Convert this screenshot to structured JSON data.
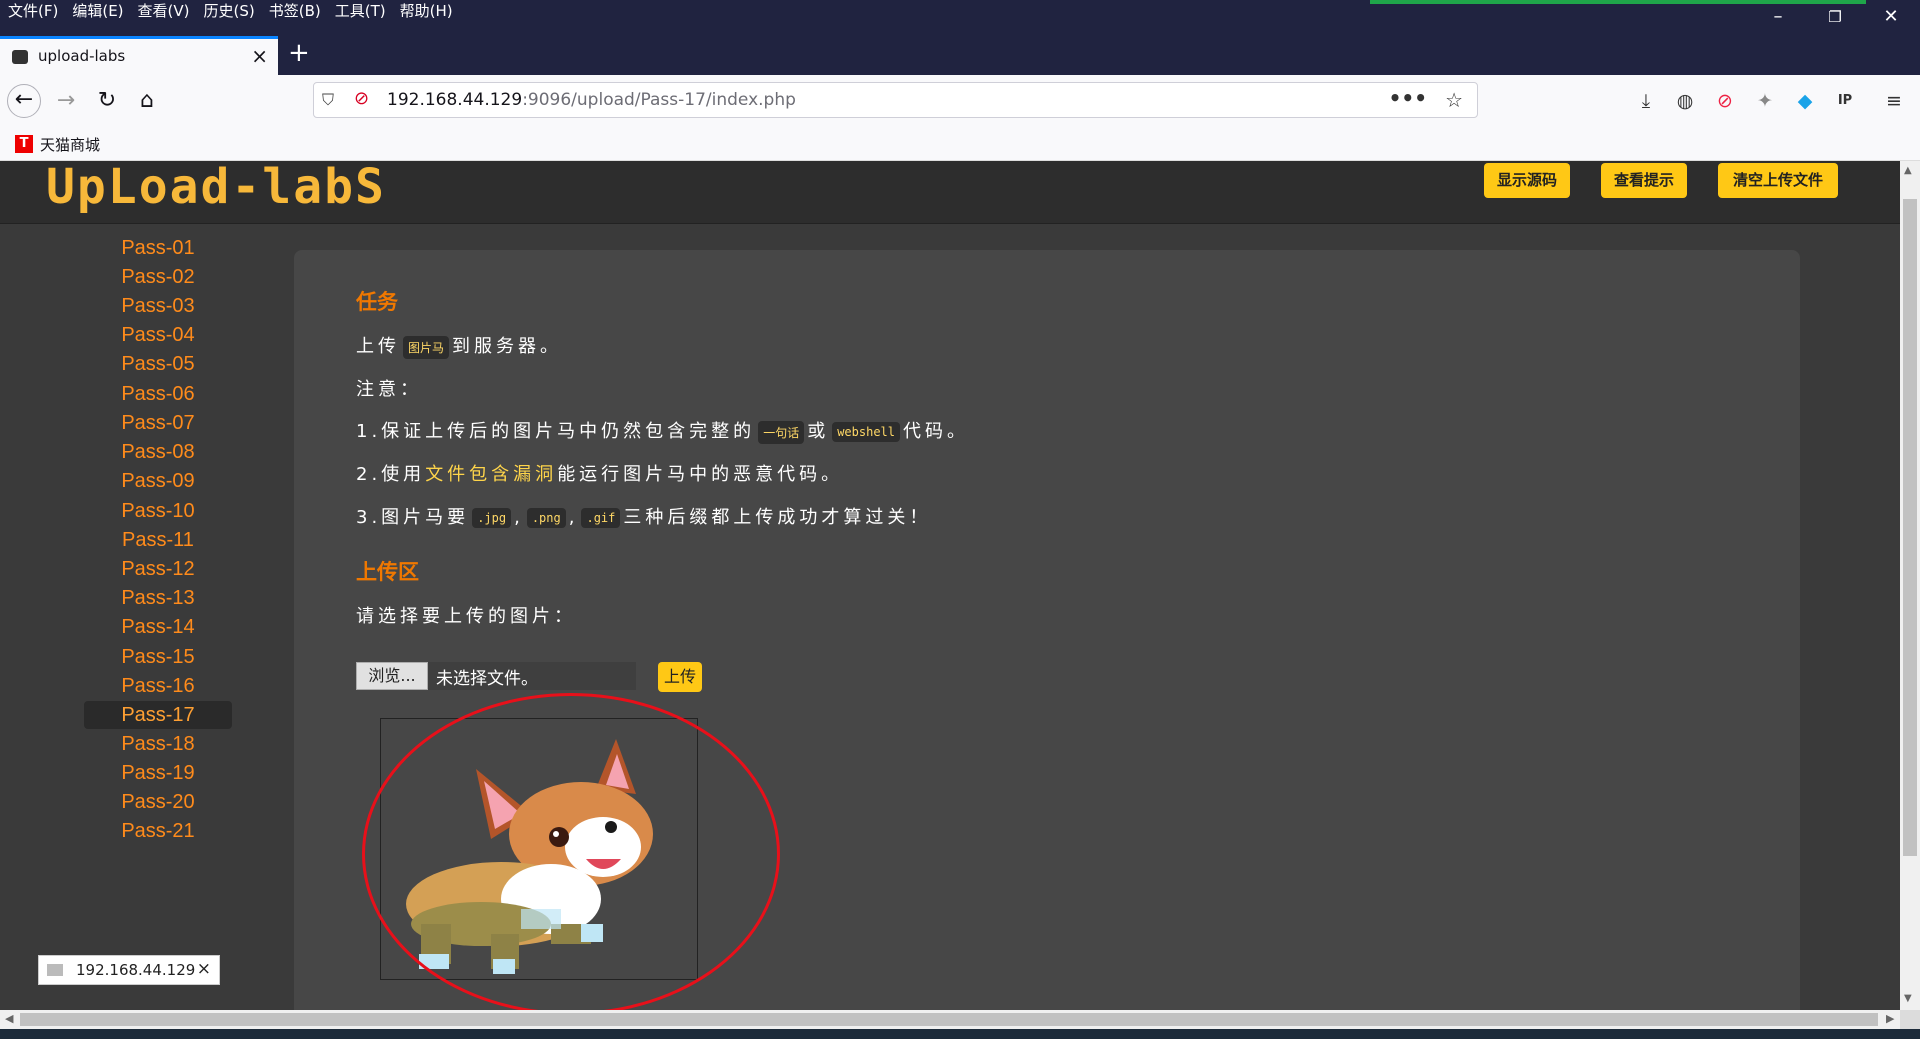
{
  "menubar": {
    "items": [
      "文件(F)",
      "编辑(E)",
      "查看(V)",
      "历史(S)",
      "书签(B)",
      "工具(T)",
      "帮助(H)"
    ]
  },
  "tab": {
    "title": "upload-labs"
  },
  "url": {
    "host": "192.168.44.129",
    "path": ":9096/upload/Pass-17/index.php"
  },
  "bookmarks": {
    "tmall_icon": "T",
    "tmall_label": "天猫商城"
  },
  "header": {
    "logo": "UpLoad-labS",
    "buttons": [
      "显示源码",
      "查看提示",
      "清空上传文件"
    ]
  },
  "sidebar": {
    "items": [
      "Pass-01",
      "Pass-02",
      "Pass-03",
      "Pass-04",
      "Pass-05",
      "Pass-06",
      "Pass-07",
      "Pass-08",
      "Pass-09",
      "Pass-10",
      "Pass-11",
      "Pass-12",
      "Pass-13",
      "Pass-14",
      "Pass-15",
      "Pass-16",
      "Pass-17",
      "Pass-18",
      "Pass-19",
      "Pass-20",
      "Pass-21"
    ],
    "active": "Pass-17"
  },
  "task": {
    "heading": "任务",
    "line1_a": "上传",
    "line1_code": "图片马",
    "line1_b": "到服务器。",
    "note": "注意：",
    "note1_a": "1.保证上传后的图片马中仍然包含完整的",
    "note1_code1": "一句话",
    "note1_b": "或",
    "note1_code2": "webshell",
    "note1_c": "代码。",
    "note2_a": "2.使用",
    "note2_hl": "文件包含漏洞",
    "note2_b": "能运行图片马中的恶意代码。",
    "note3_a": "3.图片马要",
    "note3_code1": ".jpg",
    "note3_sep": ",",
    "note3_code2": ".png",
    "note3_code3": ".gif",
    "note3_b": "三种后缀都上传成功才算过关！"
  },
  "upload": {
    "heading": "上传区",
    "prompt": "请选择要上传的图片：",
    "browse": "浏览...",
    "no_file": "未选择文件。",
    "submit": "上传"
  },
  "status": {
    "host": "192.168.44.129"
  }
}
